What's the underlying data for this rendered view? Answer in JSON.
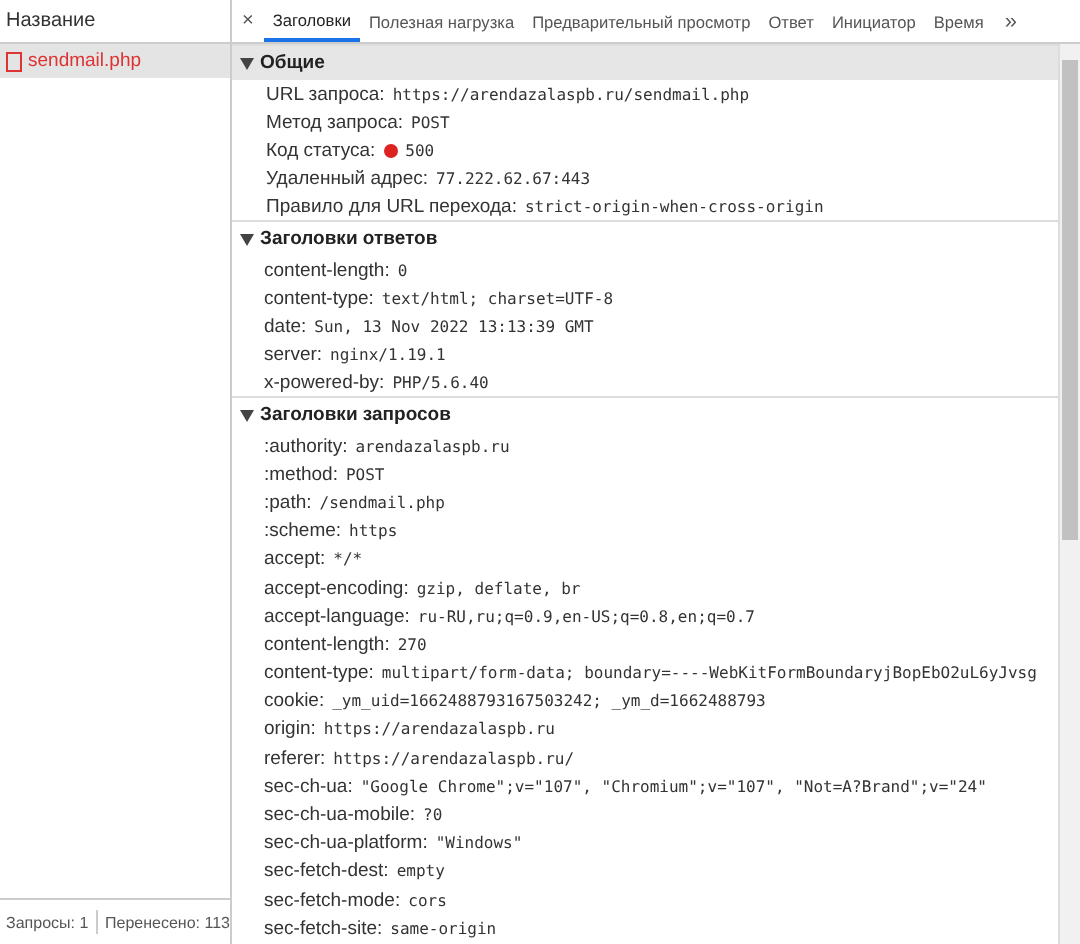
{
  "requests_panel": {
    "column_header": "Название",
    "items": [
      {
        "name": "sendmail.php",
        "selected": true,
        "failed": true
      }
    ]
  },
  "status_bar": {
    "requests": "Запросы: 1",
    "transferred": "Перенесено: 113"
  },
  "details": {
    "close": "×",
    "more": "»",
    "tabs": [
      {
        "label": "Заголовки",
        "selected": true
      },
      {
        "label": "Полезная нагрузка",
        "selected": false
      },
      {
        "label": "Предварительный просмотр",
        "selected": false
      },
      {
        "label": "Ответ",
        "selected": false
      },
      {
        "label": "Инициатор",
        "selected": false
      },
      {
        "label": "Время",
        "selected": false
      }
    ],
    "sections": [
      {
        "title": "Общие",
        "expanded": true,
        "shaded": true,
        "rows": [
          {
            "key": "URL запроса:",
            "value": "https://arendazalaspb.ru/sendmail.php"
          },
          {
            "key": "Метод запроса:",
            "value": "POST"
          },
          {
            "key": "Код статуса:",
            "value": "500",
            "status_dot": true
          },
          {
            "key": "Удаленный адрес:",
            "value": "77.222.62.67:443"
          },
          {
            "key": "Правило для URL перехода:",
            "value": "strict-origin-when-cross-origin"
          }
        ]
      },
      {
        "title": "Заголовки ответов",
        "expanded": true,
        "shaded": false,
        "rows": [
          {
            "key": "content-length:",
            "value": "0"
          },
          {
            "key": "content-type:",
            "value": "text/html; charset=UTF-8"
          },
          {
            "key": "date:",
            "value": "Sun, 13 Nov 2022 13:13:39 GMT"
          },
          {
            "key": "server:",
            "value": "nginx/1.19.1"
          },
          {
            "key": "x-powered-by:",
            "value": "PHP/5.6.40"
          }
        ]
      },
      {
        "title": "Заголовки запросов",
        "expanded": true,
        "shaded": false,
        "rows": [
          {
            "key": ":authority:",
            "value": "arendazalaspb.ru"
          },
          {
            "key": ":method:",
            "value": "POST"
          },
          {
            "key": ":path:",
            "value": "/sendmail.php"
          },
          {
            "key": ":scheme:",
            "value": "https"
          },
          {
            "key": "accept:",
            "value": "*/*"
          },
          {
            "key": "accept-encoding:",
            "value": "gzip, deflate, br"
          },
          {
            "key": "accept-language:",
            "value": "ru-RU,ru;q=0.9,en-US;q=0.8,en;q=0.7"
          },
          {
            "key": "content-length:",
            "value": "270"
          },
          {
            "key": "content-type:",
            "value": "multipart/form-data; boundary=----WebKitFormBoundaryjBopEbO2uL6yJvsg"
          },
          {
            "key": "cookie:",
            "value": "_ym_uid=1662488793167503242; _ym_d=1662488793"
          },
          {
            "key": "origin:",
            "value": "https://arendazalaspb.ru"
          },
          {
            "key": "referer:",
            "value": "https://arendazalaspb.ru/"
          },
          {
            "key": "sec-ch-ua:",
            "value": "\"Google Chrome\";v=\"107\", \"Chromium\";v=\"107\", \"Not=A?Brand\";v=\"24\""
          },
          {
            "key": "sec-ch-ua-mobile:",
            "value": "?0"
          },
          {
            "key": "sec-ch-ua-platform:",
            "value": "\"Windows\""
          },
          {
            "key": "sec-fetch-dest:",
            "value": "empty"
          },
          {
            "key": "sec-fetch-mode:",
            "value": "cors"
          },
          {
            "key": "sec-fetch-site:",
            "value": "same-origin"
          }
        ]
      }
    ]
  }
}
